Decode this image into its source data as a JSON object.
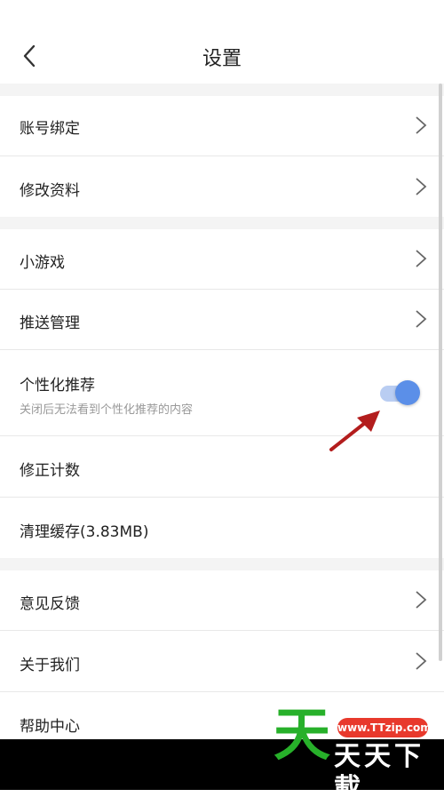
{
  "header": {
    "title": "设置"
  },
  "groups": [
    {
      "items": [
        {
          "label": "账号绑定"
        },
        {
          "label": "修改资料"
        }
      ]
    },
    {
      "items": [
        {
          "label": "小游戏"
        },
        {
          "label": "推送管理"
        },
        {
          "label": "个性化推荐",
          "sub": "关闭后无法看到个性化推荐的内容",
          "toggle_on": true
        },
        {
          "label": "修正计数"
        },
        {
          "label": "清理缓存(3.83MB)"
        }
      ]
    },
    {
      "items": [
        {
          "label": "意见反馈"
        },
        {
          "label": "关于我们"
        },
        {
          "label": "帮助中心"
        }
      ]
    }
  ],
  "watermark": {
    "logo_char": "天",
    "url": "www.TTzip.com",
    "name": "天天下載"
  },
  "colors": {
    "toggle_knob": "#5b8fe8",
    "toggle_track": "#b9cdf2",
    "arrow": "#b31d1d",
    "watermark_green": "#27b02a",
    "watermark_red": "#e8392c"
  },
  "icons": {
    "back": "chevron-left-icon",
    "chevron": "chevron-right-icon",
    "annotation": "red-arrow-icon"
  }
}
